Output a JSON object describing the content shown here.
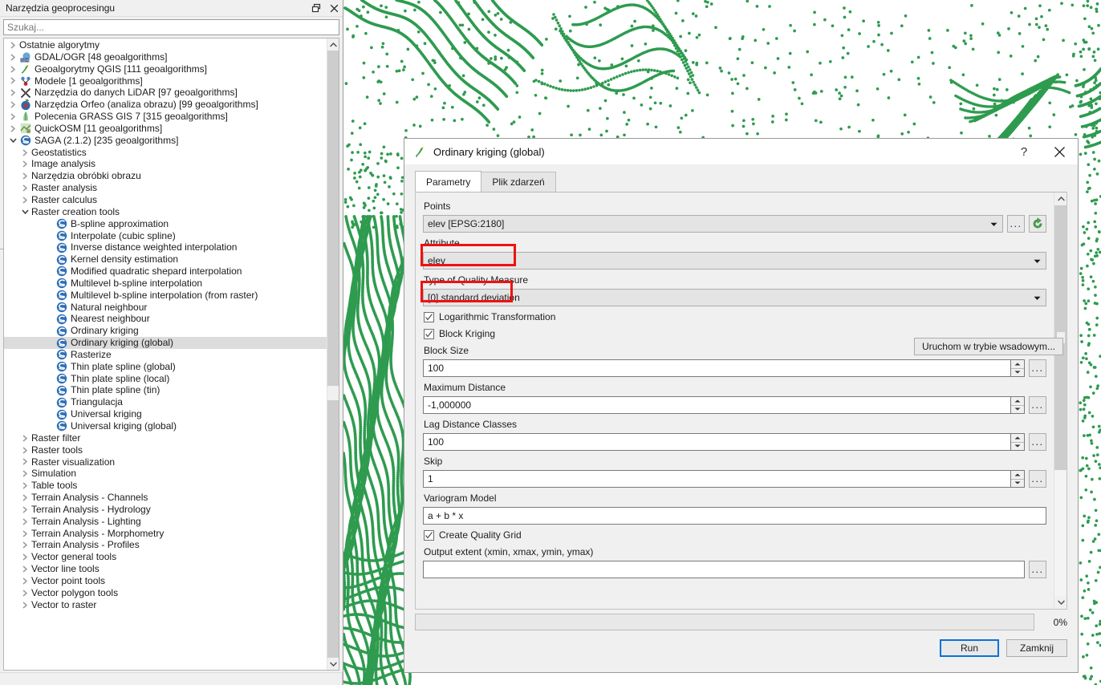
{
  "toolbox": {
    "title": "Narzędzia geoprocesingu",
    "float_icon": "restore-window-icon",
    "close_icon": "close-icon",
    "search": {
      "placeholder": "Szukaj...",
      "value": ""
    },
    "items": [
      {
        "label": "Ostatnie algorytmy",
        "depth": 0,
        "twisty": "collapsed",
        "icon": "none"
      },
      {
        "label": "GDAL/OGR [48 geoalgorithms]",
        "depth": 0,
        "twisty": "collapsed",
        "icon": "gdal-icon"
      },
      {
        "label": "Geoalgorytmy QGIS [111 geoalgorithms]",
        "depth": 0,
        "twisty": "collapsed",
        "icon": "qgis-icon"
      },
      {
        "label": "Modele [1 geoalgorithms]",
        "depth": 0,
        "twisty": "collapsed",
        "icon": "model-icon"
      },
      {
        "label": "Narzędzia do danych LiDAR [97 geoalgorithms]",
        "depth": 0,
        "twisty": "collapsed",
        "icon": "lidar-icon"
      },
      {
        "label": "Narzędzia Orfeo (analiza obrazu) [99 geoalgorithms]",
        "depth": 0,
        "twisty": "collapsed",
        "icon": "orfeo-icon"
      },
      {
        "label": "Polecenia GRASS GIS 7 [315 geoalgorithms]",
        "depth": 0,
        "twisty": "collapsed",
        "icon": "grass-icon"
      },
      {
        "label": "QuickOSM [11 geoalgorithms]",
        "depth": 0,
        "twisty": "collapsed",
        "icon": "quickosm-icon"
      },
      {
        "label": "SAGA (2.1.2) [235 geoalgorithms]",
        "depth": 0,
        "twisty": "expanded",
        "icon": "saga-icon"
      },
      {
        "label": "Geostatistics",
        "depth": 1,
        "twisty": "collapsed",
        "icon": "none"
      },
      {
        "label": "Image analysis",
        "depth": 1,
        "twisty": "collapsed",
        "icon": "none"
      },
      {
        "label": "Narzędzia obróbki obrazu",
        "depth": 1,
        "twisty": "collapsed",
        "icon": "none"
      },
      {
        "label": "Raster analysis",
        "depth": 1,
        "twisty": "collapsed",
        "icon": "none"
      },
      {
        "label": "Raster calculus",
        "depth": 1,
        "twisty": "collapsed",
        "icon": "none"
      },
      {
        "label": "Raster creation tools",
        "depth": 1,
        "twisty": "expanded",
        "icon": "none"
      },
      {
        "label": "B-spline approximation",
        "depth": 3,
        "twisty": "none",
        "icon": "saga-icon"
      },
      {
        "label": "Interpolate (cubic spline)",
        "depth": 3,
        "twisty": "none",
        "icon": "saga-icon"
      },
      {
        "label": "Inverse distance weighted interpolation",
        "depth": 3,
        "twisty": "none",
        "icon": "saga-icon"
      },
      {
        "label": "Kernel density estimation",
        "depth": 3,
        "twisty": "none",
        "icon": "saga-icon"
      },
      {
        "label": "Modified quadratic shepard interpolation",
        "depth": 3,
        "twisty": "none",
        "icon": "saga-icon"
      },
      {
        "label": "Multilevel b-spline interpolation",
        "depth": 3,
        "twisty": "none",
        "icon": "saga-icon"
      },
      {
        "label": "Multilevel b-spline interpolation (from raster)",
        "depth": 3,
        "twisty": "none",
        "icon": "saga-icon"
      },
      {
        "label": "Natural neighbour",
        "depth": 3,
        "twisty": "none",
        "icon": "saga-icon"
      },
      {
        "label": "Nearest neighbour",
        "depth": 3,
        "twisty": "none",
        "icon": "saga-icon"
      },
      {
        "label": "Ordinary kriging",
        "depth": 3,
        "twisty": "none",
        "icon": "saga-icon"
      },
      {
        "label": "Ordinary kriging (global)",
        "depth": 3,
        "twisty": "none",
        "icon": "saga-icon",
        "selected": true
      },
      {
        "label": "Rasterize",
        "depth": 3,
        "twisty": "none",
        "icon": "saga-icon"
      },
      {
        "label": "Thin plate spline (global)",
        "depth": 3,
        "twisty": "none",
        "icon": "saga-icon"
      },
      {
        "label": "Thin plate spline (local)",
        "depth": 3,
        "twisty": "none",
        "icon": "saga-icon"
      },
      {
        "label": "Thin plate spline (tin)",
        "depth": 3,
        "twisty": "none",
        "icon": "saga-icon"
      },
      {
        "label": "Triangulacja",
        "depth": 3,
        "twisty": "none",
        "icon": "saga-icon"
      },
      {
        "label": "Universal kriging",
        "depth": 3,
        "twisty": "none",
        "icon": "saga-icon"
      },
      {
        "label": "Universal kriging (global)",
        "depth": 3,
        "twisty": "none",
        "icon": "saga-icon"
      },
      {
        "label": "Raster filter",
        "depth": 1,
        "twisty": "collapsed",
        "icon": "none"
      },
      {
        "label": "Raster tools",
        "depth": 1,
        "twisty": "collapsed",
        "icon": "none"
      },
      {
        "label": "Raster visualization",
        "depth": 1,
        "twisty": "collapsed",
        "icon": "none"
      },
      {
        "label": "Simulation",
        "depth": 1,
        "twisty": "collapsed",
        "icon": "none"
      },
      {
        "label": "Table tools",
        "depth": 1,
        "twisty": "collapsed",
        "icon": "none"
      },
      {
        "label": "Terrain Analysis - Channels",
        "depth": 1,
        "twisty": "collapsed",
        "icon": "none"
      },
      {
        "label": "Terrain Analysis - Hydrology",
        "depth": 1,
        "twisty": "collapsed",
        "icon": "none"
      },
      {
        "label": "Terrain Analysis - Lighting",
        "depth": 1,
        "twisty": "collapsed",
        "icon": "none"
      },
      {
        "label": "Terrain Analysis - Morphometry",
        "depth": 1,
        "twisty": "collapsed",
        "icon": "none"
      },
      {
        "label": "Terrain Analysis - Profiles",
        "depth": 1,
        "twisty": "collapsed",
        "icon": "none"
      },
      {
        "label": "Vector general tools",
        "depth": 1,
        "twisty": "collapsed",
        "icon": "none"
      },
      {
        "label": "Vector line tools",
        "depth": 1,
        "twisty": "collapsed",
        "icon": "none"
      },
      {
        "label": "Vector point tools",
        "depth": 1,
        "twisty": "collapsed",
        "icon": "none"
      },
      {
        "label": "Vector polygon tools",
        "depth": 1,
        "twisty": "collapsed",
        "icon": "none"
      },
      {
        "label": "Vector to raster",
        "depth": 1,
        "twisty": "collapsed",
        "icon": "none"
      }
    ]
  },
  "dialog": {
    "title": "Ordinary kriging (global)",
    "title_icon": "qgis-icon",
    "help_label": "?",
    "close_label": "✕",
    "tabs": [
      {
        "label": "Parametry",
        "active": true
      },
      {
        "label": "Plik zdarzeń",
        "active": false
      }
    ],
    "batch_button": "Uruchom w trybie wsadowym...",
    "fields": {
      "points_label": "Points",
      "points_value": "elev [EPSG:2180]",
      "attribute_label": "Attribute",
      "attribute_value": "elev",
      "quality_measure_label": "Type of Quality Measure",
      "quality_measure_value": "[0] standard deviation",
      "log_transform_label": "Logarithmic Transformation",
      "log_transform_checked": true,
      "block_kriging_label": "Block Kriging",
      "block_kriging_checked": true,
      "block_size_label": "Block Size",
      "block_size_value": "100",
      "max_distance_label": "Maximum Distance",
      "max_distance_value": "-1,000000",
      "lag_distance_label": "Lag Distance Classes",
      "lag_distance_value": "100",
      "skip_label": "Skip",
      "skip_value": "1",
      "variogram_label": "Variogram Model",
      "variogram_value": "a + b * x",
      "quality_grid_label": "Create Quality Grid",
      "quality_grid_checked": true,
      "output_extent_label": "Output extent (xmin, xmax, ymin, ymax)",
      "output_extent_value": ""
    },
    "browse_button": "...",
    "refresh_icon": "refresh-icon",
    "progress": {
      "value": 0,
      "percent_label": "0%"
    },
    "buttons": {
      "run": "Run",
      "close": "Zamknij"
    }
  },
  "colors": {
    "accent_blue": "#0a72d6",
    "annotation_red": "#ee1111",
    "point_green": "#2e9b4f",
    "panel_gray": "#f0f0f0",
    "selection_gray": "#dcdcdc"
  },
  "map": {
    "layer_name": "elev",
    "symbol": "green-point-marker",
    "point_color": "#2e9b4f"
  }
}
